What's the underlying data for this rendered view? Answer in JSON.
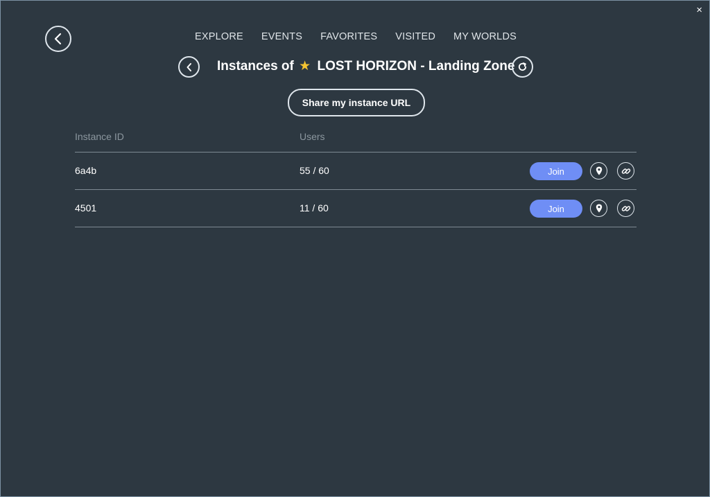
{
  "window": {
    "close_glyph": "×"
  },
  "nav": {
    "items": [
      {
        "label": "EXPLORE"
      },
      {
        "label": "EVENTS"
      },
      {
        "label": "FAVORITES"
      },
      {
        "label": "VISITED"
      },
      {
        "label": "MY WORLDS"
      }
    ]
  },
  "header": {
    "title_prefix": "Instances of",
    "star": "★",
    "world_name": "LOST HORIZON - Landing Zone"
  },
  "share_button": {
    "label": "Share my instance URL"
  },
  "table": {
    "columns": [
      "Instance ID",
      "Users"
    ],
    "rows": [
      {
        "instance_id": "6a4b",
        "users": "55 / 60",
        "join_label": "Join"
      },
      {
        "instance_id": "4501",
        "users": "11 / 60",
        "join_label": "Join"
      }
    ]
  },
  "colors": {
    "background": "#2d3841",
    "join_button": "#6f8ef5",
    "favorite_star": "#f4c431",
    "divider": "#7f8b94"
  },
  "icons": {
    "back": "chevron-left-icon",
    "refresh": "refresh-icon",
    "location": "location-pin-icon",
    "link": "link-icon",
    "close": "close-icon"
  }
}
